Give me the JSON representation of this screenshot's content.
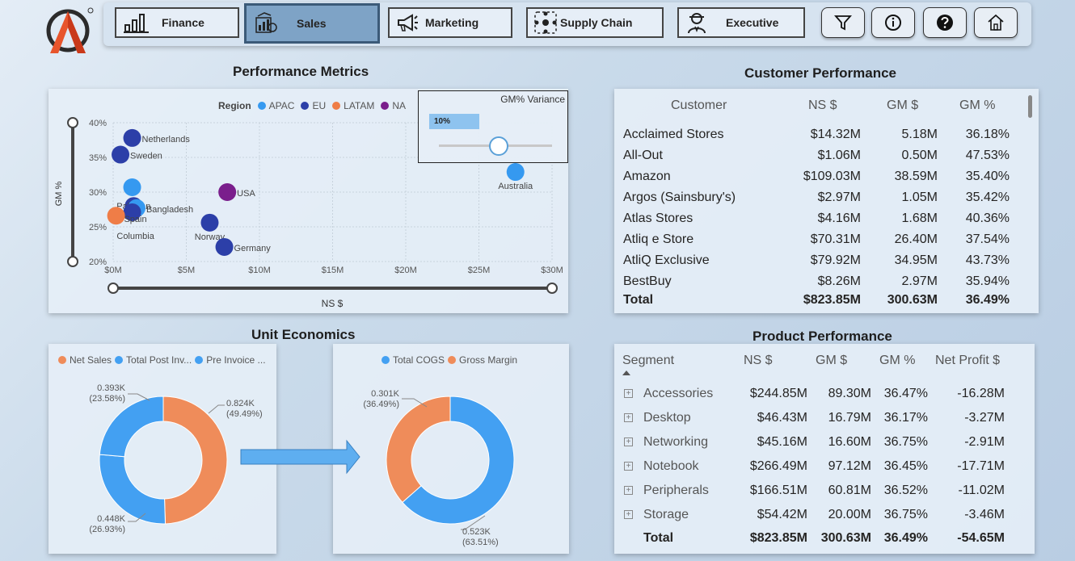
{
  "nav": {
    "buttons": [
      {
        "label": "Finance",
        "icon": "bar-chart-icon"
      },
      {
        "label": "Sales",
        "icon": "sales-report-icon"
      },
      {
        "label": "Marketing",
        "icon": "megaphone-icon"
      },
      {
        "label": "Supply Chain",
        "icon": "supply-chain-icon"
      },
      {
        "label": "Executive",
        "icon": "executive-icon"
      }
    ],
    "active": "Sales",
    "icons": [
      "filter-icon",
      "info-icon",
      "help-icon",
      "home-icon"
    ]
  },
  "performance_metrics": {
    "title": "Performance Metrics",
    "legend_title": "Region",
    "slicer": {
      "title": "GM% Variance",
      "value": "10%"
    },
    "chart_data": {
      "type": "scatter",
      "xlabel": "NS $",
      "ylabel": "GM %",
      "xlim": [
        0,
        30
      ],
      "ylim": [
        20,
        40
      ],
      "xticks": [
        "$0M",
        "$5M",
        "$10M",
        "$15M",
        "$20M",
        "$25M",
        "$30M"
      ],
      "yticks": [
        "20%",
        "25%",
        "30%",
        "35%",
        "40%"
      ],
      "series": [
        {
          "name": "APAC",
          "color": "#3599f0"
        },
        {
          "name": "EU",
          "color": "#2c3fa8"
        },
        {
          "name": "LATAM",
          "color": "#ef7d47"
        },
        {
          "name": "NA",
          "color": "#7a1e8c"
        }
      ],
      "points": [
        {
          "label": "Netherlands",
          "x": 1.3,
          "y": 37.8,
          "region": "EU"
        },
        {
          "label": "Sweden",
          "x": 0.5,
          "y": 35.4,
          "region": "EU"
        },
        {
          "label": "Australia",
          "x": 27.5,
          "y": 32.9,
          "region": "APAC"
        },
        {
          "label": "",
          "x": 1.3,
          "y": 30.7,
          "region": "APAC"
        },
        {
          "label": "USA",
          "x": 7.8,
          "y": 30.0,
          "region": "NA"
        },
        {
          "label": "Pakistan",
          "x": 1.4,
          "y": 28.0,
          "region": "EU"
        },
        {
          "label": "Bangladesh",
          "x": 1.6,
          "y": 27.7,
          "region": "APAC"
        },
        {
          "label": "Spain",
          "x": 1.3,
          "y": 27.1,
          "region": "EU"
        },
        {
          "label": "Columbia",
          "x": 0.2,
          "y": 26.6,
          "region": "LATAM"
        },
        {
          "label": "Norway",
          "x": 6.6,
          "y": 25.6,
          "region": "EU"
        },
        {
          "label": "Germany",
          "x": 7.6,
          "y": 22.1,
          "region": "EU"
        }
      ]
    }
  },
  "customer_performance": {
    "title": "Customer Performance",
    "headers": [
      "Customer",
      "NS $",
      "GM $",
      "GM %"
    ],
    "rows": [
      [
        "Acclaimed Stores",
        "$14.32M",
        "5.18M",
        "36.18%"
      ],
      [
        "All-Out",
        "$1.06M",
        "0.50M",
        "47.53%"
      ],
      [
        "Amazon",
        "$109.03M",
        "38.59M",
        "35.40%"
      ],
      [
        "Argos (Sainsbury's)",
        "$2.97M",
        "1.05M",
        "35.42%"
      ],
      [
        "Atlas Stores",
        "$4.16M",
        "1.68M",
        "40.36%"
      ],
      [
        "Atliq e Store",
        "$70.31M",
        "26.40M",
        "37.54%"
      ],
      [
        "AtliQ Exclusive",
        "$79.92M",
        "34.95M",
        "43.73%"
      ],
      [
        "BestBuy",
        "$8.26M",
        "2.97M",
        "35.94%"
      ]
    ],
    "total": [
      "Total",
      "$823.85M",
      "300.63M",
      "36.49%"
    ]
  },
  "unit_economics": {
    "title": "Unit Economics",
    "chart_data": [
      {
        "type": "pie",
        "legend": [
          "Net Sales",
          "Total Post Inv...",
          "Pre Invoice ..."
        ],
        "slices": [
          {
            "name": "Net Sales",
            "value": 0.824,
            "label": "0.824K",
            "pct": "(49.49%)",
            "color": "#ef8c5a"
          },
          {
            "name": "Total Post Invoice",
            "value": 0.448,
            "label": "0.448K",
            "pct": "(26.93%)",
            "color": "#43a0f2"
          },
          {
            "name": "Pre Invoice",
            "value": 0.393,
            "label": "0.393K",
            "pct": "(23.58%)",
            "color": "#43a0f2"
          }
        ]
      },
      {
        "type": "pie",
        "legend": [
          "Total COGS",
          "Gross Margin"
        ],
        "slices": [
          {
            "name": "Total COGS",
            "value": 0.523,
            "label": "0.523K",
            "pct": "(63.51%)",
            "color": "#43a0f2"
          },
          {
            "name": "Gross Margin",
            "value": 0.301,
            "label": "0.301K",
            "pct": "(36.49%)",
            "color": "#ef8c5a"
          }
        ]
      }
    ]
  },
  "product_performance": {
    "title": "Product Performance",
    "headers": [
      "Segment",
      "NS $",
      "GM $",
      "GM %",
      "Net Profit $"
    ],
    "rows": [
      [
        "Accessories",
        "$244.85M",
        "89.30M",
        "36.47%",
        "-16.28M"
      ],
      [
        "Desktop",
        "$46.43M",
        "16.79M",
        "36.17%",
        "-3.27M"
      ],
      [
        "Networking",
        "$45.16M",
        "16.60M",
        "36.75%",
        "-2.91M"
      ],
      [
        "Notebook",
        "$266.49M",
        "97.12M",
        "36.45%",
        "-17.71M"
      ],
      [
        "Peripherals",
        "$166.51M",
        "60.81M",
        "36.52%",
        "-11.02M"
      ],
      [
        "Storage",
        "$54.42M",
        "20.00M",
        "36.75%",
        "-3.46M"
      ]
    ],
    "total": [
      "Total",
      "$823.85M",
      "300.63M",
      "36.49%",
      "-54.65M"
    ]
  }
}
